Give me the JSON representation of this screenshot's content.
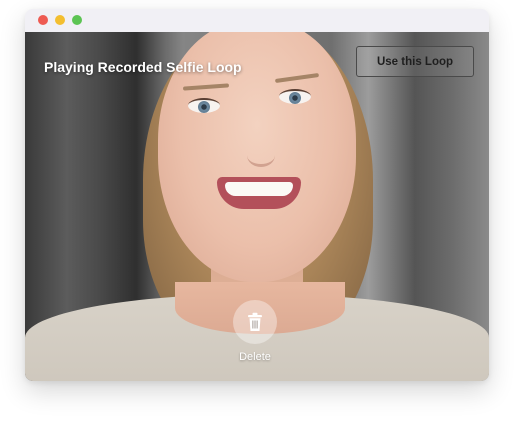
{
  "window": {
    "controls": [
      "close",
      "minimize",
      "zoom"
    ]
  },
  "player": {
    "title": "Playing Recorded Selfie Loop",
    "use_button_label": "Use this Loop",
    "delete_label": "Delete",
    "delete_icon": "trash-icon"
  },
  "colors": {
    "close_dot": "#ee5a52",
    "minimize_dot": "#f3be2f",
    "zoom_dot": "#5cc453",
    "title_text": "#ffffff"
  }
}
